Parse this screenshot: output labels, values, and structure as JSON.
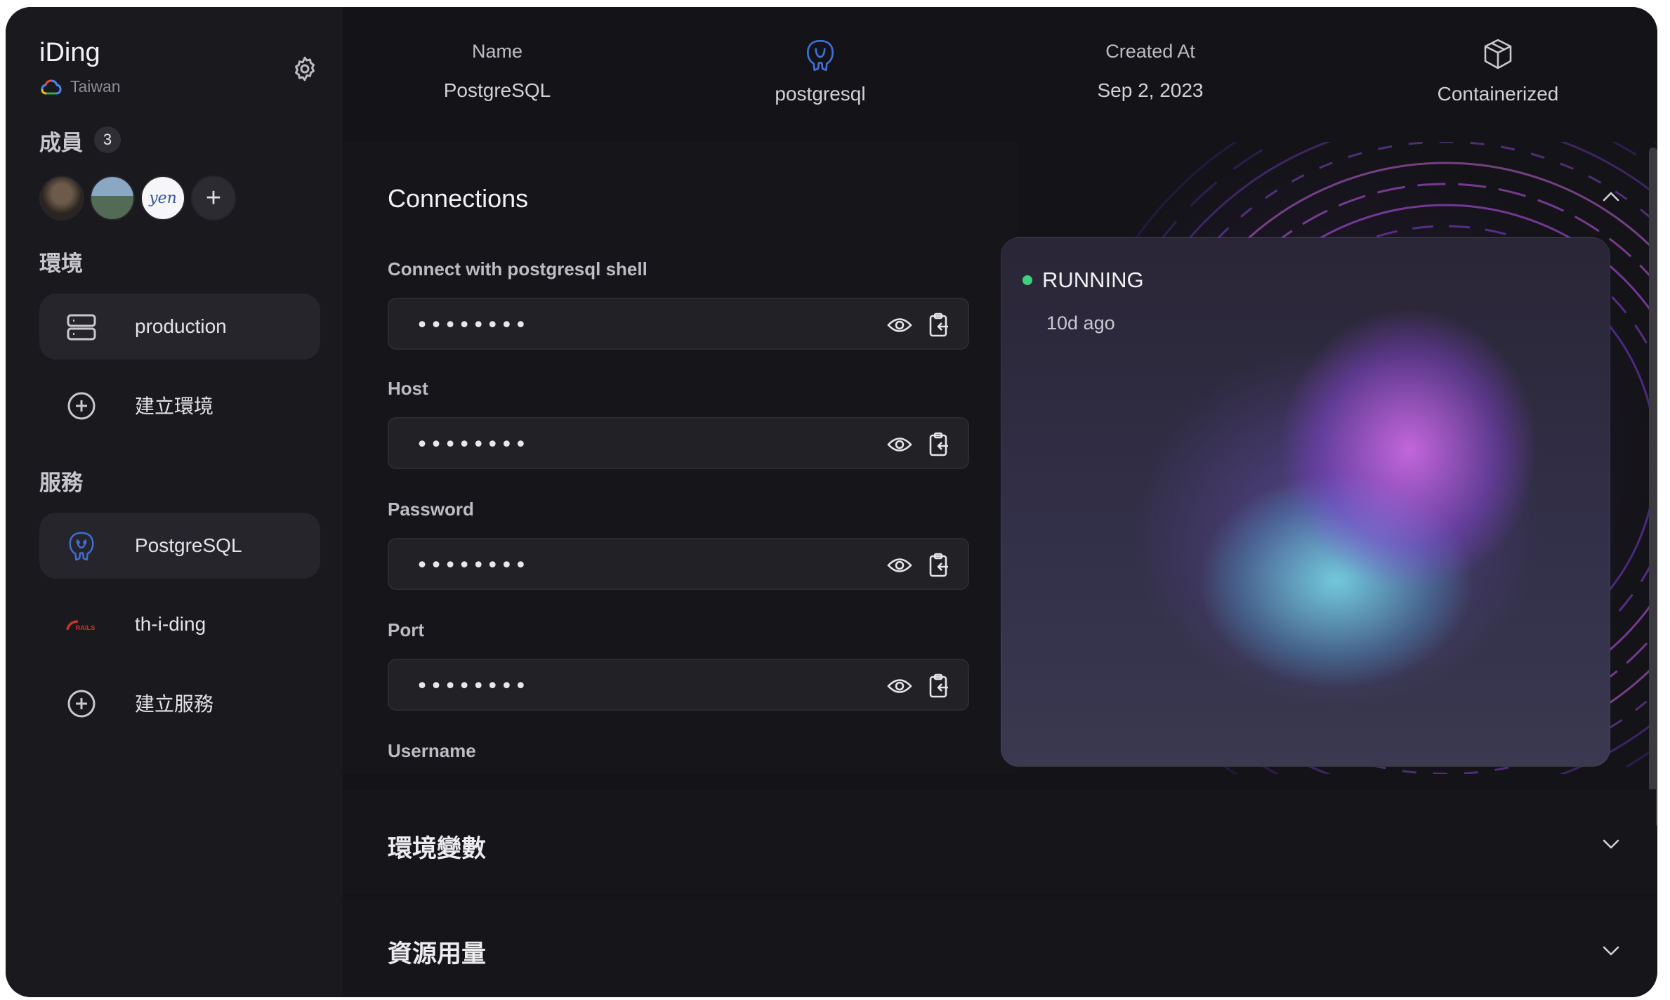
{
  "project": {
    "name": "iDing",
    "region": "Taiwan"
  },
  "members": {
    "heading": "成員",
    "count": "3",
    "avatar3_text": "yen",
    "add_glyph": "+"
  },
  "environments": {
    "heading": "環境",
    "items": [
      {
        "label": "production",
        "active": true
      }
    ],
    "create_label": "建立環境"
  },
  "services": {
    "heading": "服務",
    "items": [
      {
        "label": "PostgreSQL",
        "active": true,
        "icon": "postgresql-icon"
      },
      {
        "label": "th-i-ding",
        "active": false,
        "icon": "rails-logo-icon"
      }
    ],
    "create_label": "建立服務"
  },
  "header": {
    "name_label": "Name",
    "name_value": "PostgreSQL",
    "engine_value": "postgresql",
    "created_label": "Created At",
    "created_value": "Sep 2, 2023",
    "deploy_value": "Containerized"
  },
  "connections": {
    "title": "Connections",
    "fields": [
      {
        "label": "Connect with postgresql shell",
        "value": "********"
      },
      {
        "label": "Host",
        "value": "********"
      },
      {
        "label": "Password",
        "value": "********"
      },
      {
        "label": "Port",
        "value": "********"
      },
      {
        "label": "Username"
      }
    ]
  },
  "status": {
    "state": "RUNNING",
    "time": "10d ago",
    "color": "#3ed07a"
  },
  "sections": [
    {
      "title": "環境變數"
    },
    {
      "title": "資源用量"
    }
  ],
  "colors": {
    "background": "#141317",
    "sidebar": "#1a191e",
    "accent_postgres": "#3d6fd6",
    "rails_red": "#c8362a"
  }
}
